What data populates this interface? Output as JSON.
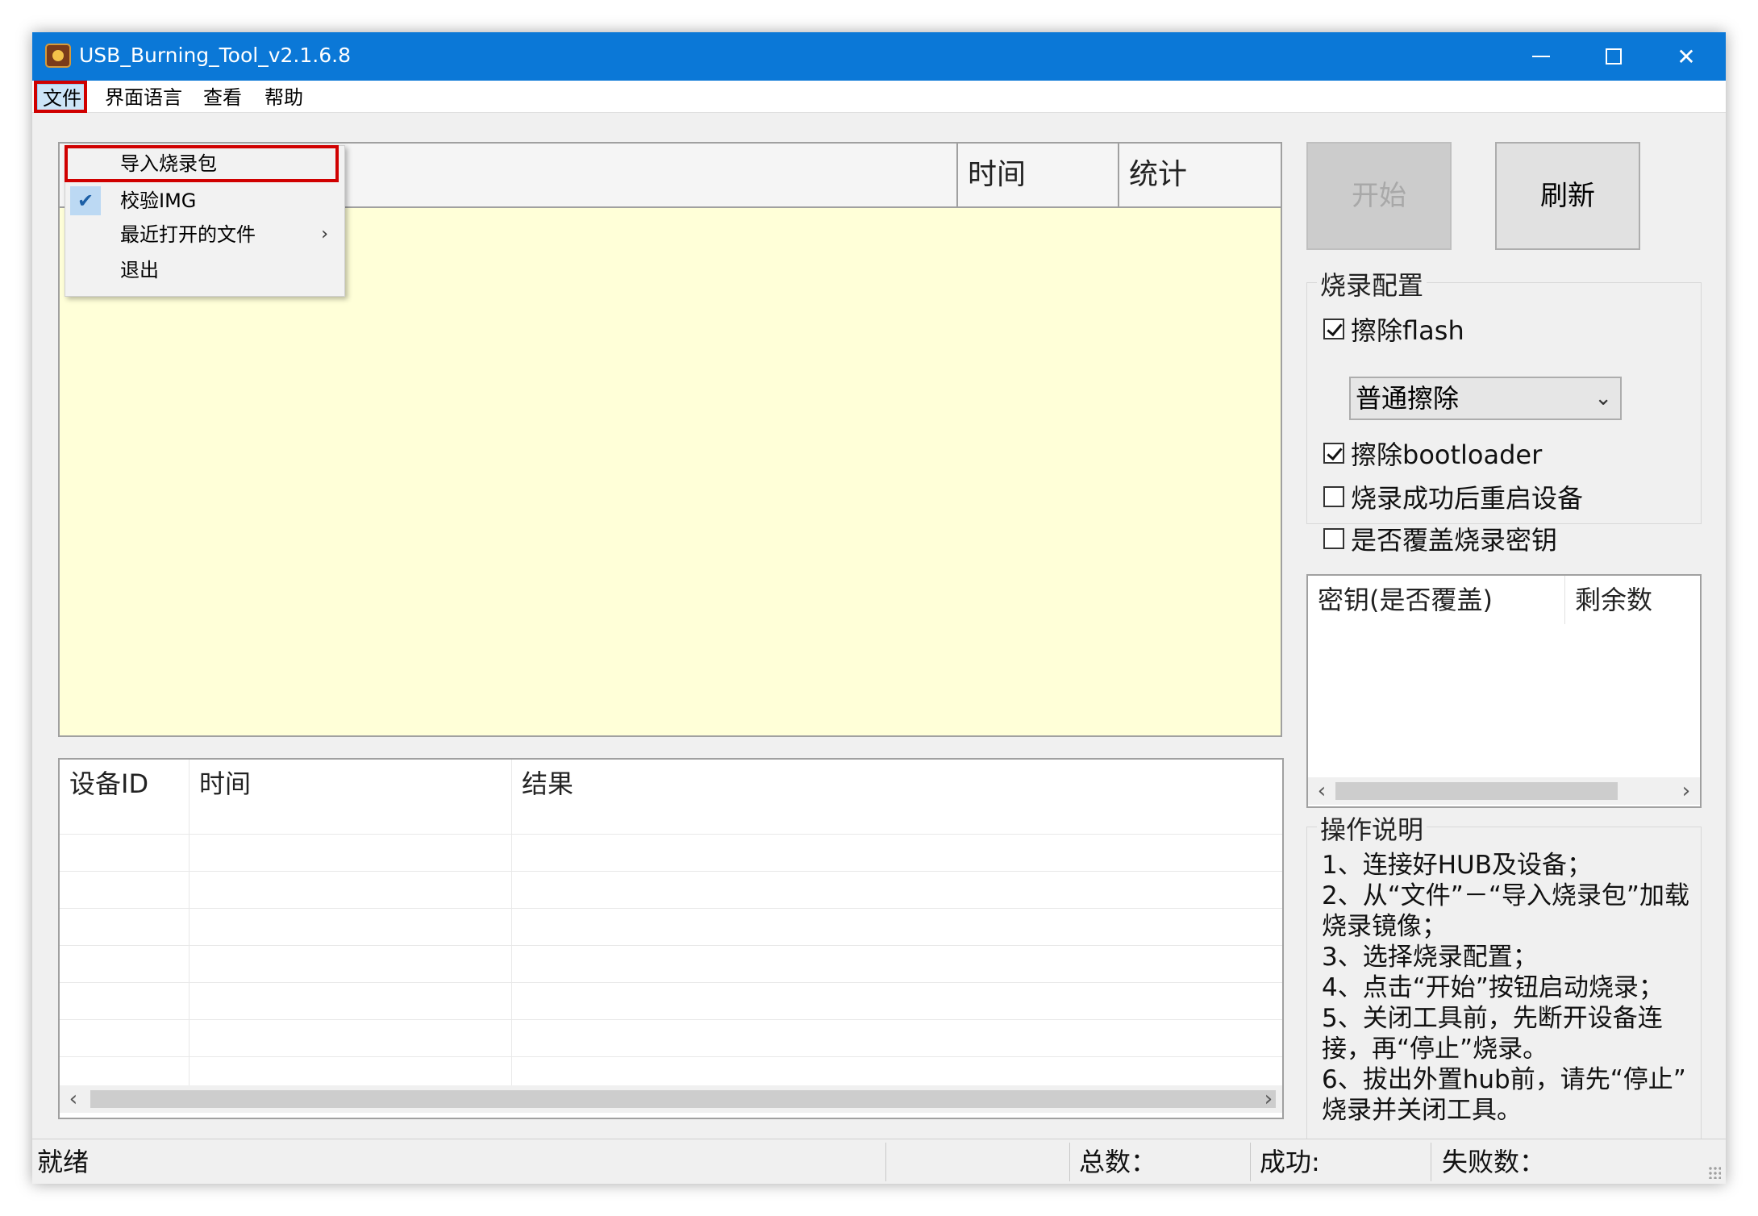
{
  "window": {
    "title": "USB_Burning_Tool_v2.1.6.8",
    "icons": {
      "app": "app-icon",
      "minimize": "minimize-icon",
      "maximize": "maximize-icon",
      "close": "close-icon"
    }
  },
  "menubar": {
    "items": [
      "文件",
      "界面语言",
      "查看",
      "帮助"
    ]
  },
  "file_menu": {
    "items": [
      {
        "label": "导入烧录包",
        "checked": false,
        "submenu": false
      },
      {
        "label": "校验IMG",
        "checked": true,
        "submenu": false
      },
      {
        "label": "最近打开的文件",
        "checked": false,
        "submenu": true
      },
      {
        "label": "退出",
        "checked": false,
        "submenu": false
      }
    ],
    "check_glyph": "✔",
    "submenu_glyph": "›"
  },
  "device_table": {
    "columns": [
      "时间",
      "统计"
    ],
    "background": "#ffffd8"
  },
  "result_table": {
    "columns": [
      "设备ID",
      "时间",
      "结果"
    ]
  },
  "buttons": {
    "start": "开始",
    "refresh": "刷新"
  },
  "burn_config": {
    "title": "烧录配置",
    "erase_flash": {
      "label": "擦除flash",
      "checked": true
    },
    "erase_mode": {
      "value": "普通擦除"
    },
    "erase_bootloader": {
      "label": "擦除bootloader",
      "checked": true
    },
    "reboot_after": {
      "label": "烧录成功后重启设备",
      "checked": false
    },
    "overwrite_key": {
      "label": "是否覆盖烧录密钥",
      "checked": false
    }
  },
  "key_table": {
    "columns": [
      "密钥(是否覆盖)",
      "剩余数"
    ]
  },
  "instructions": {
    "title": "操作说明",
    "lines": [
      "1、连接好HUB及设备；",
      "2、从“文件”－“导入烧录包”加载",
      "烧录镜像；",
      "3、选择烧录配置；",
      "4、点击“开始”按钮启动烧录；",
      "5、关闭工具前，先断开设备连",
      "接，再“停止”烧录。",
      "6、拔出外置hub前，请先“停止”",
      "烧录并关闭工具。"
    ]
  },
  "statusbar": {
    "status": "就绪",
    "total_label": "总数：",
    "success_label": "成功:",
    "fail_label": "失败数："
  },
  "colors": {
    "titlebar": "#0b78d7",
    "highlight": "#d00000",
    "window_bg": "#f0f0f0"
  }
}
